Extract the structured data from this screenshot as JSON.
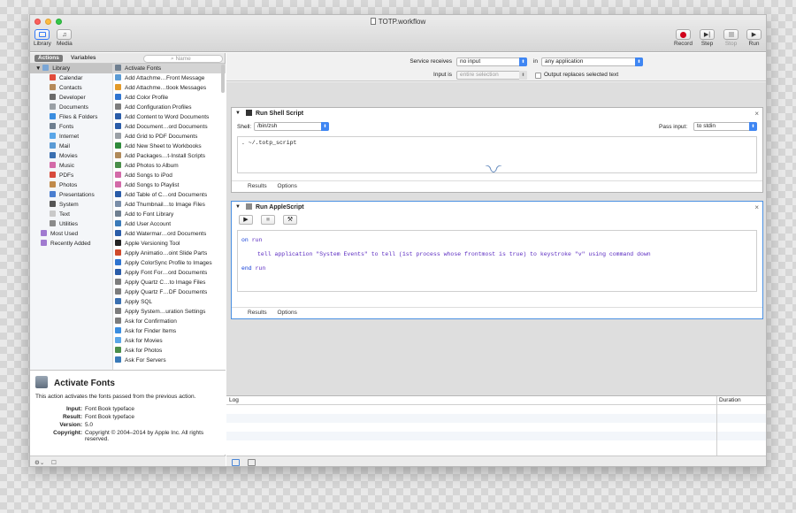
{
  "window": {
    "title": "TOTP.workflow"
  },
  "toolbar": {
    "library_label": "Library",
    "media_label": "Media",
    "record_label": "Record",
    "step_label": "Step",
    "stop_label": "Stop",
    "run_label": "Run"
  },
  "library_tabs": {
    "actions": "Actions",
    "variables": "Variables",
    "search_placeholder": "Name"
  },
  "categories": [
    {
      "label": "Library",
      "icon": "library-folder-icon",
      "color": "#7aa6d6"
    },
    {
      "label": "Calendar",
      "icon": "calendar-icon",
      "color": "#e24b3b"
    },
    {
      "label": "Contacts",
      "icon": "contacts-icon",
      "color": "#b58a5a"
    },
    {
      "label": "Developer",
      "icon": "developer-icon",
      "color": "#6a6a6a"
    },
    {
      "label": "Documents",
      "icon": "documents-icon",
      "color": "#9aa0a6"
    },
    {
      "label": "Files & Folders",
      "icon": "finder-icon",
      "color": "#3a8de0"
    },
    {
      "label": "Fonts",
      "icon": "fonts-icon",
      "color": "#6f7f90"
    },
    {
      "label": "Internet",
      "icon": "internet-icon",
      "color": "#5aa6e8"
    },
    {
      "label": "Mail",
      "icon": "mail-icon",
      "color": "#5b9bd5"
    },
    {
      "label": "Movies",
      "icon": "movies-icon",
      "color": "#3a6fb0"
    },
    {
      "label": "Music",
      "icon": "music-icon",
      "color": "#d36aa8"
    },
    {
      "label": "PDFs",
      "icon": "pdfs-icon",
      "color": "#d74a3c"
    },
    {
      "label": "Photos",
      "icon": "photos-icon",
      "color": "#c08a4a"
    },
    {
      "label": "Presentations",
      "icon": "presentations-icon",
      "color": "#4a7ed0"
    },
    {
      "label": "System",
      "icon": "system-icon",
      "color": "#555555"
    },
    {
      "label": "Text",
      "icon": "text-icon",
      "color": "#c9c9c9"
    },
    {
      "label": "Utilities",
      "icon": "utilities-icon",
      "color": "#8a8a8a"
    },
    {
      "label": "Most Used",
      "icon": "most-used-icon",
      "color": "#a07ad0"
    },
    {
      "label": "Recently Added",
      "icon": "recently-added-icon",
      "color": "#a07ad0"
    }
  ],
  "actions_list": [
    {
      "label": "Activate Fonts",
      "icon": "font-book-icon",
      "color": "#6f7f90"
    },
    {
      "label": "Add Attachme…Front Message",
      "icon": "mail-icon",
      "color": "#5b9bd5"
    },
    {
      "label": "Add Attachme…tlook Messages",
      "icon": "outlook-icon",
      "color": "#e39a2a"
    },
    {
      "label": "Add Color Profile",
      "icon": "colorsync-icon",
      "color": "#2f74d0"
    },
    {
      "label": "Add Configuration Profiles",
      "icon": "gear-icon",
      "color": "#7d7d7d"
    },
    {
      "label": "Add Content to Word Documents",
      "icon": "word-icon",
      "color": "#2a5ca8"
    },
    {
      "label": "Add Document…ord Documents",
      "icon": "word-icon",
      "color": "#2a5ca8"
    },
    {
      "label": "Add Grid to PDF Documents",
      "icon": "pdf-icon",
      "color": "#9aa0a6"
    },
    {
      "label": "Add New Sheet to Workbooks",
      "icon": "excel-icon",
      "color": "#2f8a3a"
    },
    {
      "label": "Add Packages…t-Install Scripts",
      "icon": "package-icon",
      "color": "#b08a5a"
    },
    {
      "label": "Add Photos to Album",
      "icon": "photos-icon",
      "color": "#4a8e4a"
    },
    {
      "label": "Add Songs to iPod",
      "icon": "itunes-icon",
      "color": "#d36aa8"
    },
    {
      "label": "Add Songs to Playlist",
      "icon": "itunes-icon",
      "color": "#d36aa8"
    },
    {
      "label": "Add Table of C…ord Documents",
      "icon": "word-icon",
      "color": "#2a5ca8"
    },
    {
      "label": "Add Thumbnail…to Image Files",
      "icon": "preview-icon",
      "color": "#7a8ea8"
    },
    {
      "label": "Add to Font Library",
      "icon": "font-book-icon",
      "color": "#6f7f90"
    },
    {
      "label": "Add User Account",
      "icon": "globe-icon",
      "color": "#3a7ab8"
    },
    {
      "label": "Add Watermar…ord Documents",
      "icon": "word-icon",
      "color": "#2a5ca8"
    },
    {
      "label": "Apple Versioning Tool",
      "icon": "terminal-icon",
      "color": "#222222"
    },
    {
      "label": "Apply Animatio…oint Slide Parts",
      "icon": "powerpoint-icon",
      "color": "#d04a2a"
    },
    {
      "label": "Apply ColorSync Profile to Images",
      "icon": "colorsync-icon",
      "color": "#2f74d0"
    },
    {
      "label": "Apply Font For…ord Documents",
      "icon": "word-icon",
      "color": "#2a5ca8"
    },
    {
      "label": "Apply Quartz C…to Image Files",
      "icon": "tools-icon",
      "color": "#7d7d7d"
    },
    {
      "label": "Apply Quartz F…DF Documents",
      "icon": "tools-icon",
      "color": "#7d7d7d"
    },
    {
      "label": "Apply SQL",
      "icon": "search-icon",
      "color": "#3a6fb0"
    },
    {
      "label": "Apply System…uration Settings",
      "icon": "gear-icon",
      "color": "#7d7d7d"
    },
    {
      "label": "Ask for Confirmation",
      "icon": "automator-icon",
      "color": "#7d7d7d"
    },
    {
      "label": "Ask for Finder Items",
      "icon": "finder-icon",
      "color": "#3a8de0"
    },
    {
      "label": "Ask for Movies",
      "icon": "movies-icon",
      "color": "#5aa6e8"
    },
    {
      "label": "Ask for Photos",
      "icon": "photos-icon",
      "color": "#4a8e4a"
    },
    {
      "label": "Ask For Servers",
      "icon": "globe-icon",
      "color": "#3a7ab8"
    }
  ],
  "description": {
    "title": "Activate Fonts",
    "summary": "This action activates the fonts passed from the previous action.",
    "input_key": "Input:",
    "input_val": "Font Book typeface",
    "result_key": "Result:",
    "result_val": "Font Book typeface",
    "version_key": "Version:",
    "version_val": "5.0",
    "copyright_key": "Copyright:",
    "copyright_val": "Copyright © 2004–2014 by Apple Inc. All rights reserved."
  },
  "service": {
    "receives_label": "Service receives",
    "receives_value": "no input",
    "in_label": "in",
    "app_value": "any application",
    "input_is_label": "Input is",
    "input_is_value": "entire selection",
    "output_label": "Output replaces selected text"
  },
  "shell_action": {
    "title": "Run Shell Script",
    "shell_label": "Shell:",
    "shell_value": "/bin/zsh",
    "pass_label": "Pass input:",
    "pass_value": "to stdin",
    "code": ". ~/.totp_script",
    "tab_results": "Results",
    "tab_options": "Options"
  },
  "applescript_action": {
    "title": "Run AppleScript",
    "line1_kw": "on",
    "line1_rest": " run",
    "line2": "tell application \"System Events\" to tell (1st process whose frontmost is true) to keystroke \"v\" using command down",
    "line3_kw": "end",
    "line3_rest": " run",
    "tab_results": "Results",
    "tab_options": "Options"
  },
  "log": {
    "col_log": "Log",
    "col_duration": "Duration"
  }
}
